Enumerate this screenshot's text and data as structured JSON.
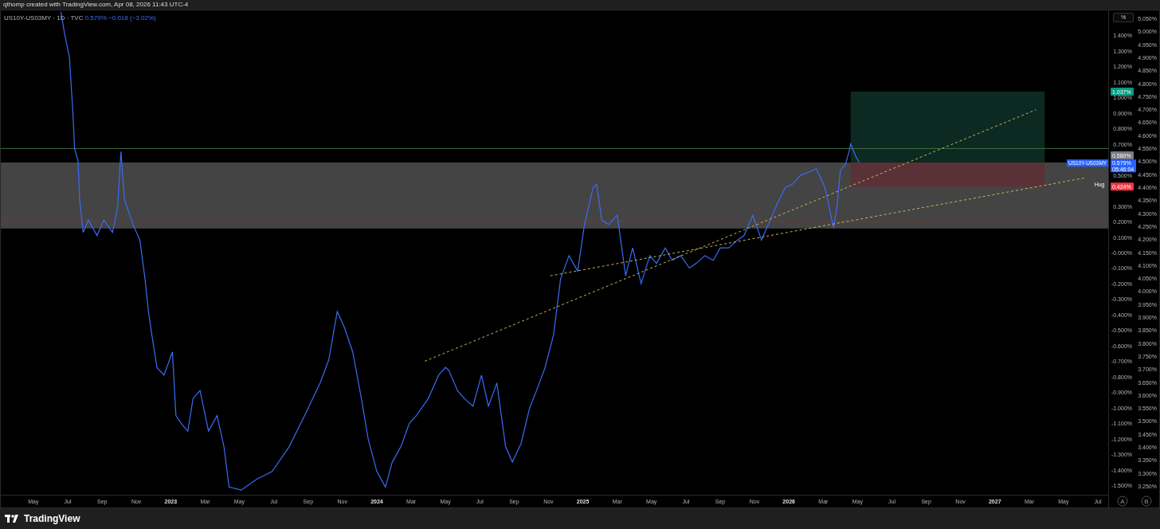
{
  "header": {
    "text": "qthomp created with TradingView.com, Apr 08, 2026 11:43 UTC-4"
  },
  "legend": {
    "symbol": "US10Y-US03MY · 1D · TVC",
    "price": "0.579%",
    "change": "−0.018 (−3.02%)"
  },
  "scale_button": "%",
  "chart": {
    "chart_data": {
      "type": "line",
      "xlim": [
        2022.175,
        2027.55
      ],
      "ylim": [
        -1.56,
        1.56
      ],
      "xticks": [
        {
          "value": 2022.333,
          "label": "May"
        },
        {
          "value": 2022.5,
          "label": "Jul"
        },
        {
          "value": 2022.667,
          "label": "Sep"
        },
        {
          "value": 2022.833,
          "label": "Nov"
        },
        {
          "value": 2023,
          "label": "2023"
        },
        {
          "value": 2023.167,
          "label": "Mar"
        },
        {
          "value": 2023.333,
          "label": "May"
        },
        {
          "value": 2023.5,
          "label": "Jul"
        },
        {
          "value": 2023.667,
          "label": "Sep"
        },
        {
          "value": 2023.833,
          "label": "Nov"
        },
        {
          "value": 2024,
          "label": "2024"
        },
        {
          "value": 2024.167,
          "label": "Mar"
        },
        {
          "value": 2024.333,
          "label": "May"
        },
        {
          "value": 2024.5,
          "label": "Jul"
        },
        {
          "value": 2024.667,
          "label": "Sep"
        },
        {
          "value": 2024.833,
          "label": "Nov"
        },
        {
          "value": 2025,
          "label": "2025"
        },
        {
          "value": 2025.167,
          "label": "Mar"
        },
        {
          "value": 2025.333,
          "label": "May"
        },
        {
          "value": 2025.5,
          "label": "Jul"
        },
        {
          "value": 2025.667,
          "label": "Sep"
        },
        {
          "value": 2025.833,
          "label": "Nov"
        },
        {
          "value": 2026,
          "label": "2026"
        },
        {
          "value": 2026.167,
          "label": "Mar"
        },
        {
          "value": 2026.333,
          "label": "May"
        },
        {
          "value": 2026.5,
          "label": "Jul"
        },
        {
          "value": 2026.667,
          "label": "Sep"
        },
        {
          "value": 2026.833,
          "label": "Nov"
        },
        {
          "value": 2027,
          "label": "2027"
        },
        {
          "value": 2027.167,
          "label": "Mar"
        },
        {
          "value": 2027.333,
          "label": "May"
        },
        {
          "value": 2027.5,
          "label": "Jul"
        }
      ],
      "yticks": [
        {
          "value": 1.4,
          "label": "1.400%"
        },
        {
          "value": 1.3,
          "label": "1.300%"
        },
        {
          "value": 1.2,
          "label": "1.200%"
        },
        {
          "value": 1.1,
          "label": "1.100%"
        },
        {
          "value": 1.0,
          "label": "1.000%"
        },
        {
          "value": 0.9,
          "label": "0.900%"
        },
        {
          "value": 0.8,
          "label": "0.800%"
        },
        {
          "value": 0.7,
          "label": "0.700%"
        },
        {
          "value": 0.5,
          "label": "0.500%"
        },
        {
          "value": 0.3,
          "label": "0.300%"
        },
        {
          "value": 0.2,
          "label": "0.200%"
        },
        {
          "value": 0.1,
          "label": "0.100%"
        },
        {
          "value": 0,
          "label": "-0.000%"
        },
        {
          "value": -0.1,
          "label": "-0.100%"
        },
        {
          "value": -0.2,
          "label": "-0.200%"
        },
        {
          "value": -0.3,
          "label": "-0.300%"
        },
        {
          "value": -0.4,
          "label": "-0.400%"
        },
        {
          "value": -0.5,
          "label": "-0.500%"
        },
        {
          "value": -0.6,
          "label": "-0.600%"
        },
        {
          "value": -0.7,
          "label": "-0.700%"
        },
        {
          "value": -0.8,
          "label": "-0.800%"
        },
        {
          "value": -0.9,
          "label": "-0.900%"
        },
        {
          "value": -1.0,
          "label": "-1.000%"
        },
        {
          "value": -1.1,
          "label": "-1.100%"
        },
        {
          "value": -1.2,
          "label": "-1.200%"
        },
        {
          "value": -1.3,
          "label": "-1.300%"
        },
        {
          "value": -1.4,
          "label": "-1.400%"
        },
        {
          "value": -1.5,
          "label": "-1.500%"
        }
      ],
      "ref_lines": [
        {
          "axis": "y",
          "value": 0.67,
          "color": "#3f6b3f"
        },
        {
          "axis": "y",
          "value": 0.2,
          "color": "#7a3434"
        }
      ],
      "x": [
        2022.467,
        2022.483,
        2022.508,
        2022.525,
        2022.533,
        2022.55,
        2022.558,
        2022.575,
        2022.6,
        2022.642,
        2022.675,
        2022.717,
        2022.742,
        2022.758,
        2022.775,
        2022.817,
        2022.85,
        2022.875,
        2022.892,
        2022.908,
        2022.933,
        2022.967,
        2023.008,
        2023.025,
        2023.05,
        2023.083,
        2023.108,
        2023.142,
        2023.183,
        2023.225,
        2023.258,
        2023.283,
        2023.342,
        2023.417,
        2023.492,
        2023.575,
        2023.65,
        2023.725,
        2023.767,
        2023.808,
        2023.842,
        2023.883,
        2023.925,
        2023.958,
        2024.0,
        2024.042,
        2024.075,
        2024.117,
        2024.158,
        2024.192,
        2024.233,
        2024.25,
        2024.3,
        2024.333,
        2024.35,
        2024.392,
        2024.425,
        2024.467,
        2024.508,
        2024.542,
        2024.583,
        2024.625,
        2024.658,
        2024.7,
        2024.742,
        2024.775,
        2024.817,
        2024.842,
        2024.858,
        2024.892,
        2024.933,
        2024.975,
        2025.008,
        2025.05,
        2025.067,
        2025.092,
        2025.125,
        2025.167,
        2025.208,
        2025.242,
        2025.283,
        2025.325,
        2025.358,
        2025.4,
        2025.433,
        2025.475,
        2025.517,
        2025.55,
        2025.592,
        2025.633,
        2025.667,
        2025.708,
        2025.75,
        2025.783,
        2025.825,
        2025.867,
        2025.9,
        2025.942,
        2025.983,
        2026.017,
        2026.058,
        2026.1,
        2026.133,
        2026.175,
        2026.217,
        2026.233,
        2026.25,
        2026.275,
        2026.292,
        2026.3,
        2026.325,
        2026.342,
        2027.2,
        2027.433
      ],
      "series": [
        {
          "name": "US10Y-US03MY",
          "color": "#3a6cf4",
          "values": [
            1.55,
            1.42,
            1.26,
            0.9,
            0.67,
            0.59,
            0.34,
            0.13,
            0.21,
            0.11,
            0.21,
            0.13,
            0.29,
            0.65,
            0.34,
            0.18,
            0.08,
            -0.17,
            -0.38,
            -0.53,
            -0.74,
            -0.79,
            -0.64,
            -1.05,
            -1.1,
            -1.15,
            -0.94,
            -0.89,
            -1.15,
            -1.05,
            -1.25,
            -1.51,
            -1.53,
            -1.46,
            -1.41,
            -1.25,
            -1.05,
            -0.84,
            -0.69,
            -0.38,
            -0.48,
            -0.64,
            -0.94,
            -1.2,
            -1.41,
            -1.51,
            -1.35,
            -1.25,
            -1.1,
            -1.05,
            null,
            -0.94,
            -0.79,
            -0.74,
            -0.76,
            -0.89,
            -0.94,
            -0.99,
            -0.79,
            -0.99,
            -0.84,
            -1.25,
            -1.35,
            -1.23,
            -1.0,
            -0.89,
            -0.74,
            null,
            -0.53,
            -0.17,
            -0.02,
            -0.12,
            0.18,
            0.42,
            0.44,
            0.21,
            0.18,
            0.24,
            -0.15,
            0.03,
            -0.2,
            -0.02,
            -0.07,
            0.03,
            -0.05,
            -0.02,
            -0.1,
            -0.07,
            -0.02,
            -0.05,
            0.03,
            0.03,
            0.08,
            0.11,
            0.24,
            0.08,
            0.18,
            0.31,
            0.42,
            0.44,
            0.5,
            0.52,
            0.54,
            0.42,
            0.16,
            0.29,
            0.53,
            0.57,
            0.65,
            0.7,
            0.62,
            0.58,
            null,
            null
          ]
        },
        {
          "color": "#c9b458",
          "line_style": "dashed",
          "values": [
            null,
            null,
            null,
            null,
            null,
            null,
            null,
            null,
            null,
            null,
            null,
            null,
            null,
            null,
            null,
            null,
            null,
            null,
            null,
            null,
            null,
            null,
            null,
            null,
            null,
            null,
            null,
            null,
            null,
            null,
            null,
            null,
            null,
            null,
            null,
            null,
            null,
            null,
            null,
            null,
            null,
            null,
            null,
            null,
            null,
            null,
            null,
            null,
            null,
            null,
            -0.7,
            null,
            null,
            null,
            null,
            null,
            null,
            null,
            null,
            null,
            null,
            null,
            null,
            null,
            null,
            null,
            null,
            null,
            null,
            null,
            null,
            null,
            null,
            null,
            null,
            null,
            null,
            null,
            null,
            null,
            null,
            null,
            null,
            null,
            null,
            null,
            null,
            null,
            null,
            null,
            null,
            null,
            null,
            null,
            null,
            null,
            null,
            null,
            null,
            null,
            null,
            null,
            null,
            null,
            null,
            null,
            null,
            null,
            null,
            null,
            null,
            null,
            0.92,
            null
          ]
        },
        {
          "color": "#c9b458",
          "line_style": "dashed",
          "values": [
            null,
            null,
            null,
            null,
            null,
            null,
            null,
            null,
            null,
            null,
            null,
            null,
            null,
            null,
            null,
            null,
            null,
            null,
            null,
            null,
            null,
            null,
            null,
            null,
            null,
            null,
            null,
            null,
            null,
            null,
            null,
            null,
            null,
            null,
            null,
            null,
            null,
            null,
            null,
            null,
            null,
            null,
            null,
            null,
            null,
            null,
            null,
            null,
            null,
            null,
            null,
            null,
            null,
            null,
            null,
            null,
            null,
            null,
            null,
            null,
            null,
            null,
            null,
            null,
            null,
            null,
            null,
            -0.15,
            null,
            null,
            null,
            null,
            null,
            null,
            null,
            null,
            null,
            null,
            null,
            null,
            null,
            null,
            null,
            null,
            null,
            null,
            null,
            null,
            null,
            null,
            null,
            null,
            null,
            null,
            null,
            null,
            null,
            null,
            null,
            null,
            null,
            null,
            null,
            null,
            null,
            null,
            null,
            null,
            null,
            null,
            null,
            null,
            null,
            0.48
          ]
        }
      ]
    },
    "note": "Hug",
    "price_tags": [
      {
        "label": "1.037%",
        "color": "#089981"
      },
      {
        "label": "0.580%",
        "color": "#787b86"
      },
      {
        "label": "0.424%",
        "color": "#f23645"
      }
    ],
    "last_price": {
      "label": "0.579%",
      "countdown": "05:46:04",
      "color": "#2962ff"
    },
    "secondary_axis": [
      "5.050%",
      "5.000%",
      "4.950%",
      "4.900%",
      "4.850%",
      "4.800%",
      "4.750%",
      "4.700%",
      "4.650%",
      "4.600%",
      "4.550%",
      "4.500%",
      "4.450%",
      "4.400%",
      "4.350%",
      "4.300%",
      "4.250%",
      "4.200%",
      "4.150%",
      "4.100%",
      "4.050%",
      "4.000%",
      "3.950%",
      "3.900%",
      "3.850%",
      "3.800%",
      "3.750%",
      "3.700%",
      "3.650%",
      "3.600%",
      "3.550%",
      "3.500%",
      "3.450%",
      "3.400%",
      "3.350%",
      "3.300%",
      "3.250%"
    ]
  },
  "axis_buttons": [
    "A",
    "B"
  ],
  "footer": {
    "logo": "TradingView"
  }
}
